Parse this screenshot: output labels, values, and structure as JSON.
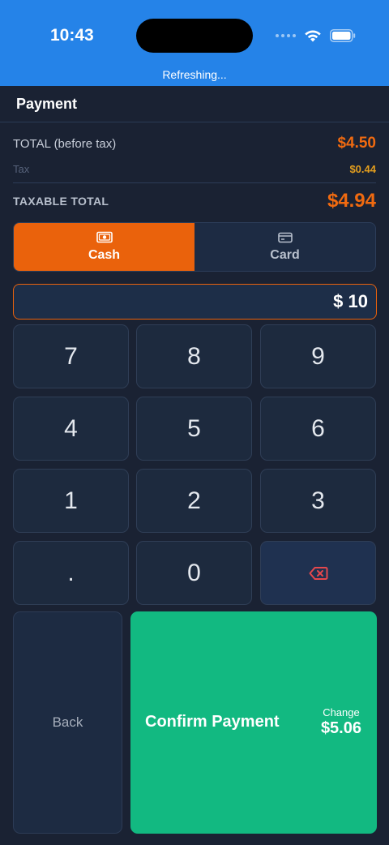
{
  "status_bar": {
    "time": "10:43",
    "refresh_text": "Refreshing..."
  },
  "header": {
    "title": "Payment"
  },
  "totals": {
    "total_label": "TOTAL (before tax)",
    "total_value": "$4.50",
    "tax_label": "Tax",
    "tax_value": "$0.44",
    "taxable_label": "TAXABLE TOTAL",
    "taxable_value": "$4.94"
  },
  "methods": {
    "cash_label": "Cash",
    "card_label": "Card",
    "selected": "Cash"
  },
  "amount": {
    "display": "$ 10"
  },
  "keypad": {
    "keys": [
      "7",
      "8",
      "9",
      "4",
      "5",
      "6",
      "1",
      "2",
      "3",
      ".",
      "0"
    ]
  },
  "actions": {
    "back_label": "Back",
    "confirm_label": "Confirm Payment",
    "change_caption": "Change",
    "change_value": "$5.06"
  },
  "colors": {
    "status_bar": "#2583e8",
    "background": "#1a2233",
    "accent_orange": "#ea620c",
    "tax_amber": "#e39e1e",
    "confirm_green": "#12b981",
    "backspace_red": "#e5484d"
  },
  "icons": {
    "cash": "cash-icon",
    "card": "card-icon",
    "backspace": "backspace-icon",
    "wifi": "wifi-icon",
    "battery": "battery-icon"
  }
}
